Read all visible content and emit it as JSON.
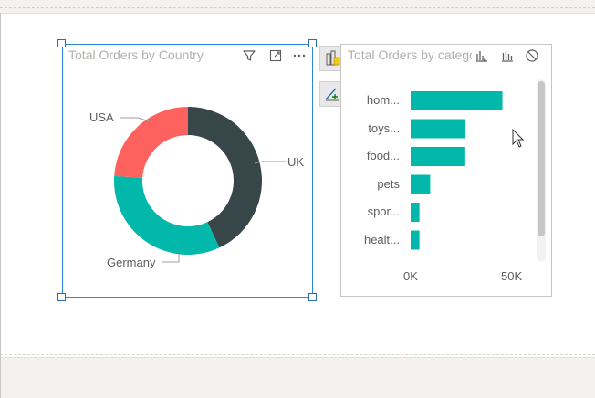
{
  "donut_visual": {
    "title": "Total Orders by Country",
    "icons": [
      "filter-icon",
      "focus-mode-icon",
      "more-options-icon"
    ]
  },
  "bar_visual": {
    "title": "Total Orders by category",
    "icons": [
      "drill-down-icon",
      "chart-icon",
      "block-icon"
    ]
  },
  "side_buttons": [
    "format-visual-icon",
    "analytics-icon"
  ],
  "chart_data": [
    {
      "type": "pie",
      "title": "Total Orders by Country",
      "categories": [
        "UK",
        "Germany",
        "USA"
      ],
      "values": [
        43,
        33,
        24
      ],
      "colors": [
        "#374649",
        "#01b8aa",
        "#fd625e"
      ],
      "donut": true
    },
    {
      "type": "bar",
      "orientation": "horizontal",
      "title": "Total Orders by category",
      "categories": [
        "hom...",
        "toys...",
        "food...",
        "pets",
        "spor...",
        "healt..."
      ],
      "values": [
        47000,
        28000,
        27500,
        10000,
        4500,
        4500
      ],
      "xlim": [
        0,
        60000
      ],
      "tick_labels": [
        "0K",
        "50K"
      ],
      "tick_values": [
        0,
        50000
      ],
      "color": "#01b8aa"
    }
  ]
}
